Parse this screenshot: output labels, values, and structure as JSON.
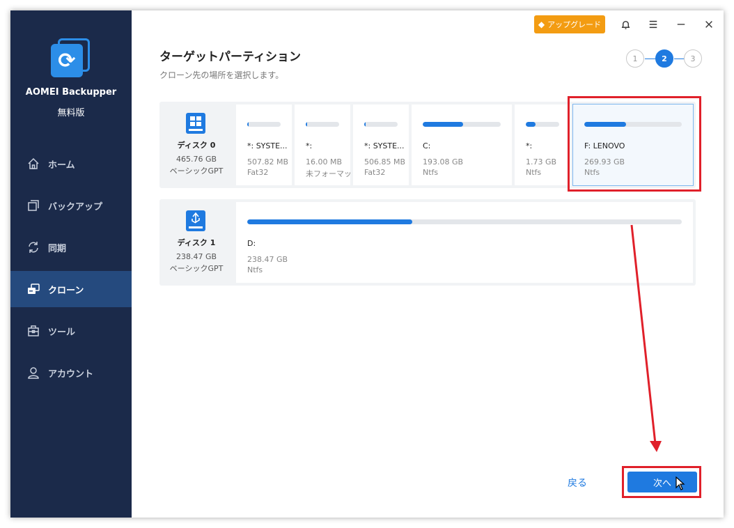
{
  "app": {
    "name": "AOMEI Backupper",
    "edition": "無料版",
    "upgrade_label": "アップグレード"
  },
  "sidebar": {
    "items": [
      {
        "label": "ホーム",
        "icon": "home-icon"
      },
      {
        "label": "バックアップ",
        "icon": "backup-icon"
      },
      {
        "label": "同期",
        "icon": "sync-icon"
      },
      {
        "label": "クローン",
        "icon": "clone-icon",
        "active": true
      },
      {
        "label": "ツール",
        "icon": "tools-icon"
      },
      {
        "label": "アカウント",
        "icon": "account-icon"
      }
    ]
  },
  "header": {
    "title": "ターゲットパーティション",
    "subtitle": "クローン先の場所を選択します。"
  },
  "steps": [
    "1",
    "2",
    "3"
  ],
  "current_step": 2,
  "disks": [
    {
      "name": "ディスク 0",
      "size": "465.76 GB",
      "type": "ベーシックGPT",
      "partitions": [
        {
          "name": "*: SYSTE...",
          "size": "507.82 MB",
          "fs": "Fat32",
          "used": 0.05
        },
        {
          "name": "*:",
          "size": "16.00 MB",
          "fs": "未フォーマット",
          "used": 0.05
        },
        {
          "name": "*: SYSTE...",
          "size": "506.85 MB",
          "fs": "Fat32",
          "used": 0.05
        },
        {
          "name": "C:",
          "size": "193.08 GB",
          "fs": "Ntfs",
          "used": 0.52
        },
        {
          "name": "*:",
          "size": "1.73 GB",
          "fs": "Ntfs",
          "used": 0.3
        },
        {
          "name": "F: LENOVO",
          "size": "269.93 GB",
          "fs": "Ntfs",
          "used": 0.43,
          "selected": true
        }
      ]
    },
    {
      "name": "ディスク 1",
      "size": "238.47 GB",
      "type": "ベーシックGPT",
      "partitions": [
        {
          "name": "D:",
          "size": "238.47 GB",
          "fs": "Ntfs",
          "used": 0.38
        }
      ]
    }
  ],
  "footer": {
    "back_label": "戻る",
    "next_label": "次へ"
  },
  "colors": {
    "sidebar_bg": "#1b2a4a",
    "sidebar_active": "#254a7e",
    "accent": "#1f7ae0",
    "upgrade": "#f39c12",
    "annotation": "#e0202a"
  }
}
